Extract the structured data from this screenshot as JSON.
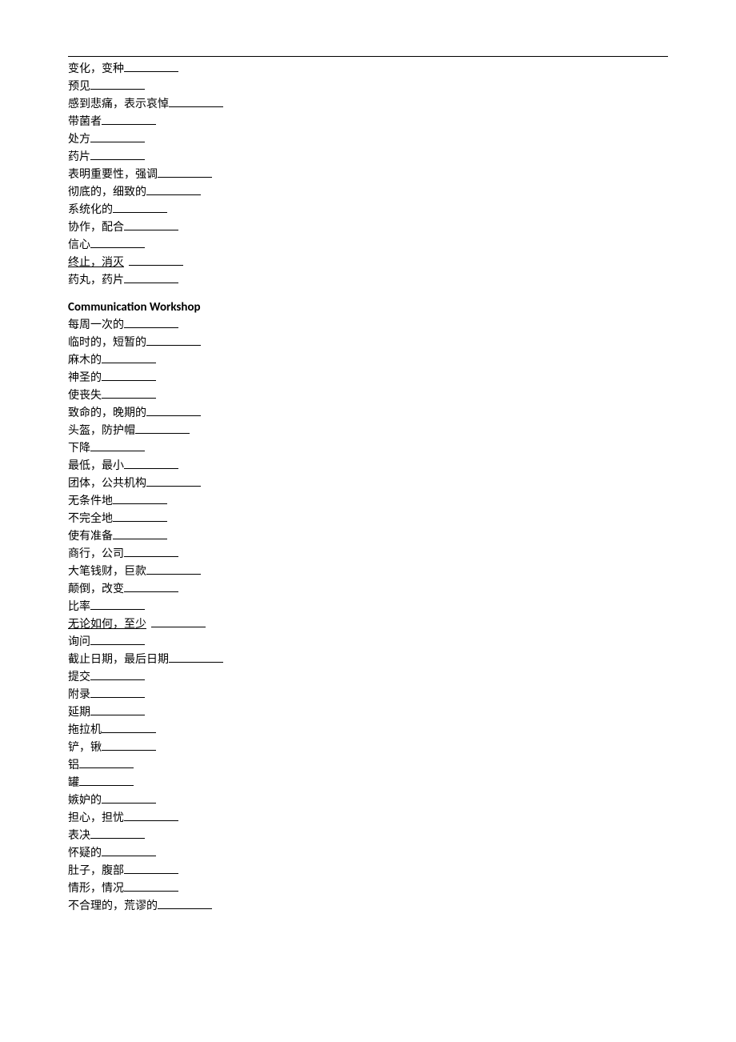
{
  "section1": {
    "items": [
      {
        "term": "变化，变种",
        "underlined": false
      },
      {
        "term": "预见",
        "underlined": false
      },
      {
        "term": "感到悲痛，表示哀悼",
        "underlined": false
      },
      {
        "term": "带菌者",
        "underlined": false
      },
      {
        "term": "处方",
        "underlined": false
      },
      {
        "term": "药片",
        "underlined": false
      },
      {
        "term": "表明重要性，强调",
        "underlined": false
      },
      {
        "term": "彻底的，细致的",
        "underlined": false
      },
      {
        "term": "系统化的",
        "underlined": false
      },
      {
        "term": "协作，配合",
        "underlined": false
      },
      {
        "term": "信心",
        "underlined": false
      },
      {
        "term": "终止，消灭",
        "underlined": true
      },
      {
        "term": "药丸，药片",
        "underlined": false
      }
    ]
  },
  "section2": {
    "title": "Communication Workshop",
    "items": [
      {
        "term": "每周一次的",
        "underlined": false
      },
      {
        "term": "临时的，短暂的",
        "underlined": false
      },
      {
        "term": "麻木的",
        "underlined": false
      },
      {
        "term": "神圣的",
        "underlined": false
      },
      {
        "term": "使丧失",
        "underlined": false
      },
      {
        "term": "致命的，晚期的",
        "underlined": false
      },
      {
        "term": "头盔，防护帽",
        "underlined": false
      },
      {
        "term": "下降",
        "underlined": false
      },
      {
        "term": "最低，最小",
        "underlined": false
      },
      {
        "term": "团体，公共机构",
        "underlined": false
      },
      {
        "term": "无条件地",
        "underlined": false
      },
      {
        "term": "不完全地",
        "underlined": false
      },
      {
        "term": "使有准备",
        "underlined": false
      },
      {
        "term": "商行，公司",
        "underlined": false
      },
      {
        "term": "大笔钱财，巨款",
        "underlined": false
      },
      {
        "term": "颠倒，改变",
        "underlined": false
      },
      {
        "term": "比率",
        "underlined": false
      },
      {
        "term": "无论如何，至少",
        "underlined": true
      },
      {
        "term": "询问",
        "underlined": false
      },
      {
        "term": "截止日期，最后日期",
        "underlined": false
      },
      {
        "term": "提交",
        "underlined": false
      },
      {
        "term": "附录",
        "underlined": false
      },
      {
        "term": "延期",
        "underlined": false
      },
      {
        "term": "拖拉机",
        "underlined": false
      },
      {
        "term": "铲，锹",
        "underlined": false
      },
      {
        "term": "铝",
        "underlined": false
      },
      {
        "term": "罐",
        "underlined": false
      },
      {
        "term": "嫉妒的",
        "underlined": false
      },
      {
        "term": "担心，担忧",
        "underlined": false
      },
      {
        "term": "表决",
        "underlined": false
      },
      {
        "term": "怀疑的",
        "underlined": false
      },
      {
        "term": "肚子，腹部",
        "underlined": false
      },
      {
        "term": "情形，情况",
        "underlined": false
      },
      {
        "term": "不合理的，荒谬的",
        "underlined": false
      }
    ]
  }
}
